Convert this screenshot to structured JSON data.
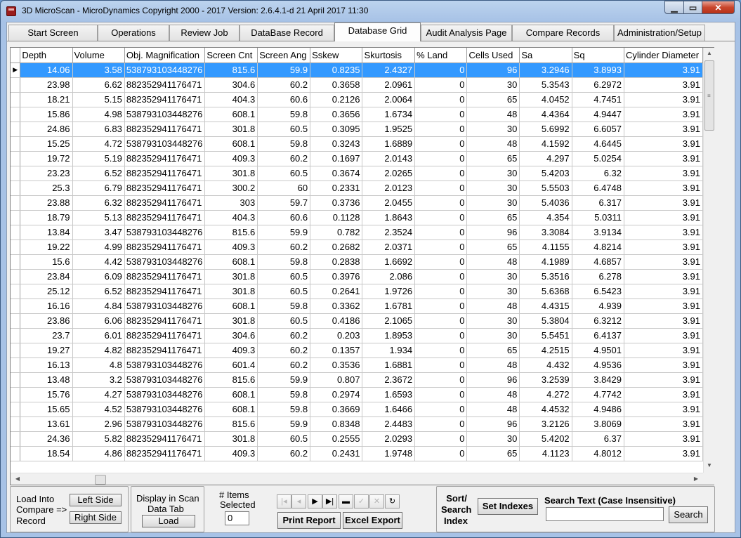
{
  "window": {
    "title": "3D MicroScan  -  MicroDynamics  Copyright 2000 - 2017  Version: 2.6.4.1-d  21 April 2017 11:30"
  },
  "tabs": [
    {
      "label": "Start Screen"
    },
    {
      "label": "Operations"
    },
    {
      "label": "Review Job"
    },
    {
      "label": "DataBase Record"
    },
    {
      "label": "Database Grid"
    },
    {
      "label": "Audit Analysis Page"
    },
    {
      "label": "Compare Records"
    },
    {
      "label": "Administration/Setup"
    }
  ],
  "grid": {
    "columns": [
      "Depth",
      "Volume",
      "Obj. Magnification",
      "Screen Cnt",
      "Screen Ang",
      "Sskew",
      "Skurtosis",
      "% Land",
      "Cells Used",
      "Sa",
      "Sq",
      "Cylinder Diameter"
    ],
    "rows": [
      [
        "14.06",
        "3.58",
        "538793103448276",
        "815.6",
        "59.9",
        "0.8235",
        "2.4327",
        "0",
        "96",
        "3.2946",
        "3.8993",
        "3.91"
      ],
      [
        "23.98",
        "6.62",
        "882352941176471",
        "304.6",
        "60.2",
        "0.3658",
        "2.0961",
        "0",
        "30",
        "5.3543",
        "6.2972",
        "3.91"
      ],
      [
        "18.21",
        "5.15",
        "882352941176471",
        "404.3",
        "60.6",
        "0.2126",
        "2.0064",
        "0",
        "65",
        "4.0452",
        "4.7451",
        "3.91"
      ],
      [
        "15.86",
        "4.98",
        "538793103448276",
        "608.1",
        "59.8",
        "0.3656",
        "1.6734",
        "0",
        "48",
        "4.4364",
        "4.9447",
        "3.91"
      ],
      [
        "24.86",
        "6.83",
        "882352941176471",
        "301.8",
        "60.5",
        "0.3095",
        "1.9525",
        "0",
        "30",
        "5.6992",
        "6.6057",
        "3.91"
      ],
      [
        "15.25",
        "4.72",
        "538793103448276",
        "608.1",
        "59.8",
        "0.3243",
        "1.6889",
        "0",
        "48",
        "4.1592",
        "4.6445",
        "3.91"
      ],
      [
        "19.72",
        "5.19",
        "882352941176471",
        "409.3",
        "60.2",
        "0.1697",
        "2.0143",
        "0",
        "65",
        "4.297",
        "5.0254",
        "3.91"
      ],
      [
        "23.23",
        "6.52",
        "882352941176471",
        "301.8",
        "60.5",
        "0.3674",
        "2.0265",
        "0",
        "30",
        "5.4203",
        "6.32",
        "3.91"
      ],
      [
        "25.3",
        "6.79",
        "882352941176471",
        "300.2",
        "60",
        "0.2331",
        "2.0123",
        "0",
        "30",
        "5.5503",
        "6.4748",
        "3.91"
      ],
      [
        "23.88",
        "6.32",
        "882352941176471",
        "303",
        "59.7",
        "0.3736",
        "2.0455",
        "0",
        "30",
        "5.4036",
        "6.317",
        "3.91"
      ],
      [
        "18.79",
        "5.13",
        "882352941176471",
        "404.3",
        "60.6",
        "0.1128",
        "1.8643",
        "0",
        "65",
        "4.354",
        "5.0311",
        "3.91"
      ],
      [
        "13.84",
        "3.47",
        "538793103448276",
        "815.6",
        "59.9",
        "0.782",
        "2.3524",
        "0",
        "96",
        "3.3084",
        "3.9134",
        "3.91"
      ],
      [
        "19.22",
        "4.99",
        "882352941176471",
        "409.3",
        "60.2",
        "0.2682",
        "2.0371",
        "0",
        "65",
        "4.1155",
        "4.8214",
        "3.91"
      ],
      [
        "15.6",
        "4.42",
        "538793103448276",
        "608.1",
        "59.8",
        "0.2838",
        "1.6692",
        "0",
        "48",
        "4.1989",
        "4.6857",
        "3.91"
      ],
      [
        "23.84",
        "6.09",
        "882352941176471",
        "301.8",
        "60.5",
        "0.3976",
        "2.086",
        "0",
        "30",
        "5.3516",
        "6.278",
        "3.91"
      ],
      [
        "25.12",
        "6.52",
        "882352941176471",
        "301.8",
        "60.5",
        "0.2641",
        "1.9726",
        "0",
        "30",
        "5.6368",
        "6.5423",
        "3.91"
      ],
      [
        "16.16",
        "4.84",
        "538793103448276",
        "608.1",
        "59.8",
        "0.3362",
        "1.6781",
        "0",
        "48",
        "4.4315",
        "4.939",
        "3.91"
      ],
      [
        "23.86",
        "6.06",
        "882352941176471",
        "301.8",
        "60.5",
        "0.4186",
        "2.1065",
        "0",
        "30",
        "5.3804",
        "6.3212",
        "3.91"
      ],
      [
        "23.7",
        "6.01",
        "882352941176471",
        "304.6",
        "60.2",
        "0.203",
        "1.8953",
        "0",
        "30",
        "5.5451",
        "6.4137",
        "3.91"
      ],
      [
        "19.27",
        "4.82",
        "882352941176471",
        "409.3",
        "60.2",
        "0.1357",
        "1.934",
        "0",
        "65",
        "4.2515",
        "4.9501",
        "3.91"
      ],
      [
        "16.13",
        "4.8",
        "538793103448276",
        "601.4",
        "60.2",
        "0.3536",
        "1.6881",
        "0",
        "48",
        "4.432",
        "4.9536",
        "3.91"
      ],
      [
        "13.48",
        "3.2",
        "538793103448276",
        "815.6",
        "59.9",
        "0.807",
        "2.3672",
        "0",
        "96",
        "3.2539",
        "3.8429",
        "3.91"
      ],
      [
        "15.76",
        "4.27",
        "538793103448276",
        "608.1",
        "59.8",
        "0.2974",
        "1.6593",
        "0",
        "48",
        "4.272",
        "4.7742",
        "3.91"
      ],
      [
        "15.65",
        "4.52",
        "538793103448276",
        "608.1",
        "59.8",
        "0.3669",
        "1.6466",
        "0",
        "48",
        "4.4532",
        "4.9486",
        "3.91"
      ],
      [
        "13.61",
        "2.96",
        "538793103448276",
        "815.6",
        "59.9",
        "0.8348",
        "2.4483",
        "0",
        "96",
        "3.2126",
        "3.8069",
        "3.91"
      ],
      [
        "24.36",
        "5.82",
        "882352941176471",
        "301.8",
        "60.5",
        "0.2555",
        "2.0293",
        "0",
        "30",
        "5.4202",
        "6.37",
        "3.91"
      ],
      [
        "18.54",
        "4.86",
        "882352941176471",
        "409.3",
        "60.2",
        "0.2431",
        "1.9748",
        "0",
        "65",
        "4.1123",
        "4.8012",
        "3.91"
      ]
    ],
    "selected_row": 0
  },
  "bottom": {
    "load_compare_label": [
      "Load Into",
      "Compare =>",
      "Record"
    ],
    "left_side": "Left Side",
    "right_side": "Right Side",
    "display_scan_label": [
      "Display in Scan",
      "Data Tab"
    ],
    "load": "Load",
    "items_selected_label": [
      "# Items",
      "Selected"
    ],
    "items_selected_value": "0",
    "print_report": "Print Report",
    "excel_export": "Excel Export",
    "sort_label": [
      "Sort/",
      "Search",
      "Index"
    ],
    "set_indexes": "Set Indexes",
    "search_text_label": "Search Text (Case Insensitive)",
    "search_value": "",
    "search": "Search"
  },
  "icons": {
    "nav": [
      "first-icon",
      "prev-icon",
      "next-icon",
      "last-icon",
      "delete-icon",
      "post-icon",
      "cancel-icon",
      "refresh-icon"
    ]
  }
}
